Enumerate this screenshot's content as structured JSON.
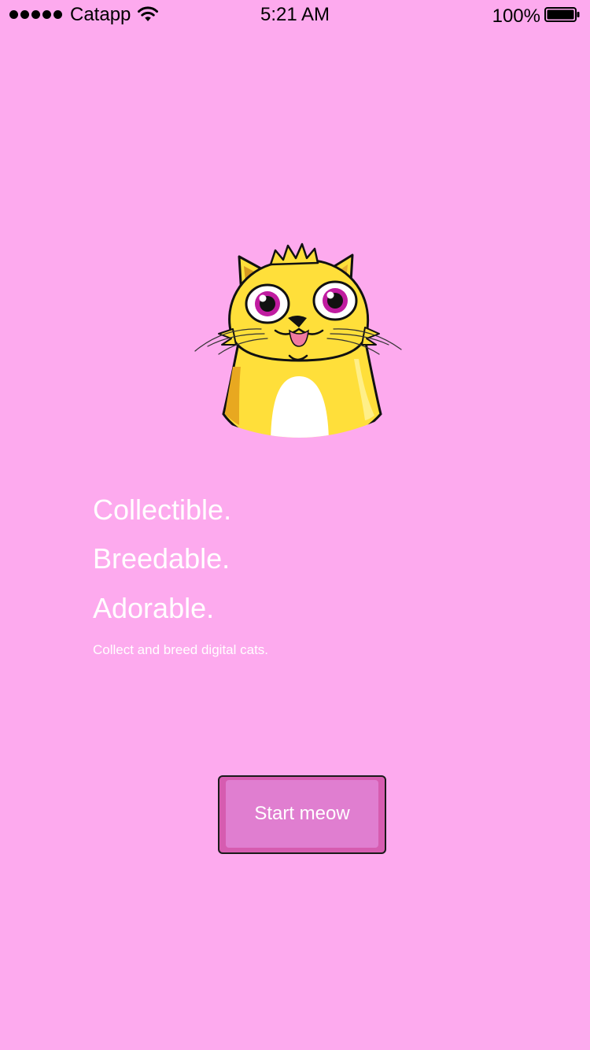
{
  "theme": {
    "background": "#fdaaee",
    "text_color": "#ffffff",
    "button_outer": "#d65cb0",
    "button_inner": "#e07ed0",
    "button_border": "#1a1a1a"
  },
  "status_bar": {
    "signal_icon": "signal-dots-icon",
    "carrier": "Catapp",
    "wifi_icon": "wifi-icon",
    "time": "5:21 AM",
    "battery_percent": "100%",
    "battery_icon": "battery-icon",
    "battery_level": 1.0
  },
  "hero": {
    "illustration": "cat-illustration"
  },
  "headlines": [
    "Collectible.",
    "Breedable.",
    "Adorable."
  ],
  "tagline": "Collect and breed digital cats.",
  "start_button": {
    "label": "Start meow"
  }
}
